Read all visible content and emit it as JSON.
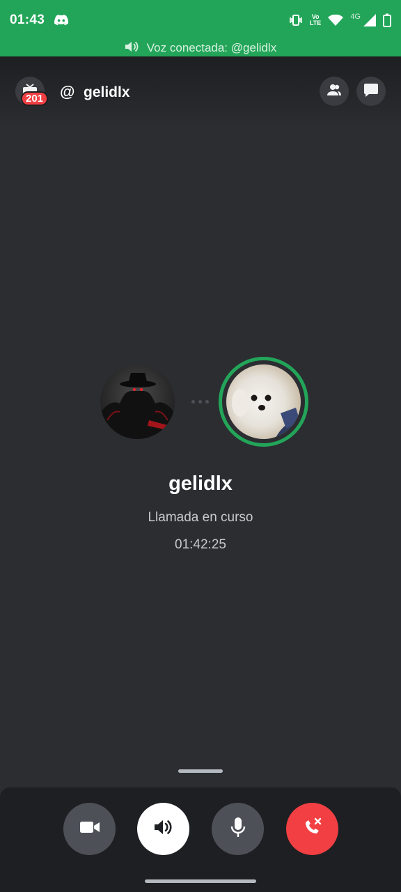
{
  "status_bar": {
    "time": "01:43",
    "network_label": "4G",
    "volte_label": "Vo\nLTE",
    "icons": [
      "discord-icon",
      "vibrate-icon",
      "volte-icon",
      "wifi-icon",
      "signal-icon",
      "battery-icon"
    ]
  },
  "banner": {
    "text": "Voz conectada: @gelidlx",
    "icon": "speaker-icon"
  },
  "header": {
    "badge_count": "201",
    "at_symbol": "@",
    "title": "gelidlx",
    "icons": [
      "tv-icon",
      "people-icon",
      "chat-icon"
    ]
  },
  "call": {
    "name": "gelidlx",
    "status": "Llamada en curso",
    "duration": "01:42:25",
    "speaking_ring_color": "#23a559"
  },
  "controls": {
    "buttons": [
      {
        "name": "video",
        "icon": "video-camera-icon"
      },
      {
        "name": "speaker",
        "icon": "speaker-icon"
      },
      {
        "name": "mic",
        "icon": "microphone-icon"
      },
      {
        "name": "hangup",
        "icon": "phone-hangup-icon"
      }
    ]
  },
  "colors": {
    "accent_green": "#23a559",
    "background": "#2b2d31",
    "danger_red": "#f23f43"
  }
}
